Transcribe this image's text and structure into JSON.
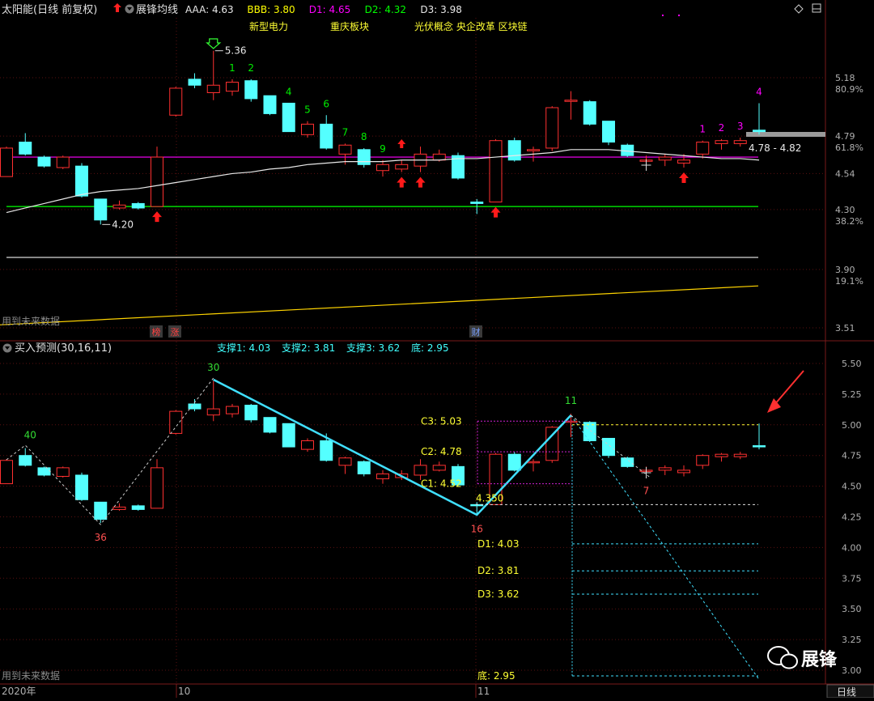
{
  "top_header": {
    "stock": "太阳能(日线 前复权)",
    "indicator": "展锋均线",
    "items": [
      {
        "text": "AAA: 4.63",
        "color": "#e8e8e8"
      },
      {
        "text": "BBB: 3.80",
        "color": "#ffff00"
      },
      {
        "text": "D1: 4.65",
        "color": "#ff00ff"
      },
      {
        "text": "D2: 4.32",
        "color": "#00ff00"
      },
      {
        "text": "D3: 3.98",
        "color": "#e8e8e8"
      }
    ]
  },
  "sector_tags": [
    "新型电力",
    "重庆板块",
    "光伏概念 央企改革 区块链"
  ],
  "bottom_header": {
    "indicator": "买入预测(30,16,11)",
    "items": [
      {
        "text": "支撑1: 4.03"
      },
      {
        "text": "支撑2: 3.81"
      },
      {
        "text": "支撑3: 3.62"
      },
      {
        "text": "底: 2.95"
      }
    ]
  },
  "future_data_label": "用到未来数据",
  "event_tags": [
    "榜",
    "涨",
    "财"
  ],
  "x_axis_labels": [
    "2020年",
    "10",
    "11"
  ],
  "period_label": "日线",
  "watermark": "展锋",
  "chart_data": [
    {
      "type": "candlestick",
      "panel": "main",
      "y_ticks": [
        {
          "value": 5.18,
          "label": "5.18",
          "pct": "80.9%"
        },
        {
          "value": 4.79,
          "label": "4.79",
          "pct": "61.8%"
        },
        {
          "value": 4.54,
          "label": "4.54",
          "pct": ""
        },
        {
          "value": 4.3,
          "label": "4.30",
          "pct": "38.2%"
        },
        {
          "value": 3.9,
          "label": "3.90",
          "pct": "19.1%"
        },
        {
          "value": 3.51,
          "label": "3.51",
          "pct": ""
        }
      ],
      "ylim": [
        3.45,
        5.45
      ],
      "candles": [
        {
          "o": 4.52,
          "h": 4.72,
          "l": 4.52,
          "c": 4.71
        },
        {
          "o": 4.75,
          "h": 4.81,
          "l": 4.66,
          "c": 4.67
        },
        {
          "o": 4.65,
          "h": 4.66,
          "l": 4.58,
          "c": 4.59
        },
        {
          "o": 4.58,
          "h": 4.66,
          "l": 4.57,
          "c": 4.65
        },
        {
          "o": 4.59,
          "h": 4.61,
          "l": 4.38,
          "c": 4.39
        },
        {
          "o": 4.37,
          "h": 4.37,
          "l": 4.2,
          "c": 4.23
        },
        {
          "o": 4.31,
          "h": 4.36,
          "l": 4.3,
          "c": 4.33
        },
        {
          "o": 4.34,
          "h": 4.35,
          "l": 4.3,
          "c": 4.31
        },
        {
          "o": 4.32,
          "h": 4.72,
          "l": 4.32,
          "c": 4.65
        },
        {
          "o": 4.93,
          "h": 5.12,
          "l": 4.92,
          "c": 5.11
        },
        {
          "o": 5.17,
          "h": 5.21,
          "l": 5.11,
          "c": 5.13
        },
        {
          "o": 5.08,
          "h": 5.36,
          "l": 5.03,
          "c": 5.13
        },
        {
          "o": 5.09,
          "h": 5.17,
          "l": 5.06,
          "c": 5.15
        },
        {
          "o": 5.16,
          "h": 5.17,
          "l": 5.02,
          "c": 5.04
        },
        {
          "o": 5.06,
          "h": 5.06,
          "l": 4.93,
          "c": 4.94
        },
        {
          "o": 5.01,
          "h": 5.01,
          "l": 4.82,
          "c": 4.82
        },
        {
          "o": 4.8,
          "h": 4.89,
          "l": 4.78,
          "c": 4.87
        },
        {
          "o": 4.87,
          "h": 4.93,
          "l": 4.7,
          "c": 4.71
        },
        {
          "o": 4.67,
          "h": 4.74,
          "l": 4.6,
          "c": 4.73
        },
        {
          "o": 4.7,
          "h": 4.71,
          "l": 4.58,
          "c": 4.6
        },
        {
          "o": 4.56,
          "h": 4.63,
          "l": 4.52,
          "c": 4.6
        },
        {
          "o": 4.57,
          "h": 4.63,
          "l": 4.55,
          "c": 4.6
        },
        {
          "o": 4.59,
          "h": 4.72,
          "l": 4.55,
          "c": 4.67
        },
        {
          "o": 4.63,
          "h": 4.7,
          "l": 4.62,
          "c": 4.67
        },
        {
          "o": 4.66,
          "h": 4.68,
          "l": 4.5,
          "c": 4.51
        },
        {
          "o": 4.35,
          "h": 4.37,
          "l": 4.27,
          "c": 4.34
        },
        {
          "o": 4.35,
          "h": 4.77,
          "l": 4.35,
          "c": 4.76
        },
        {
          "o": 4.76,
          "h": 4.78,
          "l": 4.62,
          "c": 4.63
        },
        {
          "o": 4.7,
          "h": 4.72,
          "l": 4.62,
          "c": 4.7
        },
        {
          "o": 4.71,
          "h": 4.99,
          "l": 4.69,
          "c": 4.98
        },
        {
          "o": 5.03,
          "h": 5.09,
          "l": 4.9,
          "c": 5.03
        },
        {
          "o": 5.02,
          "h": 5.03,
          "l": 4.86,
          "c": 4.87
        },
        {
          "o": 4.89,
          "h": 4.89,
          "l": 4.73,
          "c": 4.75
        },
        {
          "o": 4.73,
          "h": 4.74,
          "l": 4.65,
          "c": 4.66
        },
        {
          "o": 4.63,
          "h": 4.66,
          "l": 4.58,
          "c": 4.63
        },
        {
          "o": 4.63,
          "h": 4.67,
          "l": 4.59,
          "c": 4.65
        },
        {
          "o": 4.61,
          "h": 4.67,
          "l": 4.58,
          "c": 4.63
        },
        {
          "o": 4.67,
          "h": 4.76,
          "l": 4.64,
          "c": 4.75
        },
        {
          "o": 4.74,
          "h": 4.77,
          "l": 4.7,
          "c": 4.76
        },
        {
          "o": 4.74,
          "h": 4.78,
          "l": 4.72,
          "c": 4.76
        },
        {
          "o": 4.83,
          "h": 5.01,
          "l": 4.8,
          "c": 4.82
        }
      ],
      "hlines": [
        {
          "name": "D1",
          "value": 4.65,
          "color": "#ff00ff"
        },
        {
          "name": "D2",
          "value": 4.32,
          "color": "#00ff00"
        },
        {
          "name": "D3",
          "value": 3.98,
          "color": "#d8d8d8"
        }
      ],
      "ma_line": [
        4.28,
        4.31,
        4.34,
        4.37,
        4.4,
        4.42,
        4.43,
        4.44,
        4.46,
        4.48,
        4.5,
        4.52,
        4.54,
        4.55,
        4.57,
        4.58,
        4.6,
        4.61,
        4.62,
        4.62,
        4.62,
        4.63,
        4.63,
        4.63,
        4.64,
        4.64,
        4.65,
        4.66,
        4.67,
        4.68,
        4.7,
        4.7,
        4.7,
        4.69,
        4.68,
        4.67,
        4.66,
        4.65,
        4.64,
        4.64,
        4.63
      ],
      "bbb_line": {
        "start": 3.53,
        "end": 3.79
      },
      "annotations": [
        {
          "i": 11,
          "price": 5.36,
          "text": "5.36"
        },
        {
          "i": 5,
          "price": 4.2,
          "text": "4.20"
        }
      ],
      "count_labels": [
        {
          "i": 12,
          "text": "1",
          "color": "#00ee00",
          "pos": "above"
        },
        {
          "i": 13,
          "text": "2",
          "color": "#00ee00",
          "pos": "above"
        },
        {
          "i": 15,
          "text": "4",
          "color": "#00ee00",
          "pos": "above"
        },
        {
          "i": 16,
          "text": "5",
          "color": "#00ee00",
          "pos": "above"
        },
        {
          "i": 17,
          "text": "6",
          "color": "#00ee00",
          "pos": "above"
        },
        {
          "i": 18,
          "text": "7",
          "color": "#00ee00",
          "pos": "above"
        },
        {
          "i": 19,
          "text": "8",
          "color": "#00ee00",
          "pos": "above"
        },
        {
          "i": 20,
          "text": "9",
          "color": "#00ee00",
          "pos": "above"
        },
        {
          "i": 37,
          "text": "1",
          "color": "#ff00ff",
          "pos": "above"
        },
        {
          "i": 38,
          "text": "2",
          "color": "#ff00ff",
          "pos": "above"
        },
        {
          "i": 39,
          "text": "3",
          "color": "#ff00ff",
          "pos": "above"
        },
        {
          "i": 40,
          "text": "4",
          "color": "#ff00ff",
          "pos": "above"
        }
      ],
      "up_arrows": [
        8,
        21,
        22,
        26,
        36
      ],
      "price_range_label": "4.78 - 4.82"
    },
    {
      "type": "candlestick",
      "panel": "sub",
      "y_ticks": [
        5.5,
        5.25,
        5.0,
        4.75,
        4.5,
        4.25,
        4.0,
        3.75,
        3.5,
        3.25,
        3.0
      ],
      "ylim": [
        2.95,
        5.55
      ],
      "peak_trough_labels": [
        {
          "i": 1,
          "text": "40",
          "pos": "above"
        },
        {
          "i": 5,
          "text": "36",
          "pos": "below"
        },
        {
          "i": 11,
          "text": "30",
          "pos": "above"
        },
        {
          "i": 25,
          "text": "16",
          "pos": "below"
        },
        {
          "i": 30,
          "text": "11",
          "pos": "above"
        },
        {
          "i": 34,
          "text": "7",
          "pos": "below"
        }
      ],
      "c_levels": [
        {
          "text": "C3: 5.03",
          "value": 5.03
        },
        {
          "text": "C2: 4.78",
          "value": 4.78
        },
        {
          "text": "C1: 4.52",
          "value": 4.52
        }
      ],
      "low_label": "4.350",
      "d_levels": [
        {
          "text": "D1: 4.03",
          "value": 4.03
        },
        {
          "text": "D2: 3.81",
          "value": 3.81
        },
        {
          "text": "D3: 3.62",
          "value": 3.62
        },
        {
          "text": "底: 2.95",
          "value": 2.95
        }
      ]
    }
  ]
}
